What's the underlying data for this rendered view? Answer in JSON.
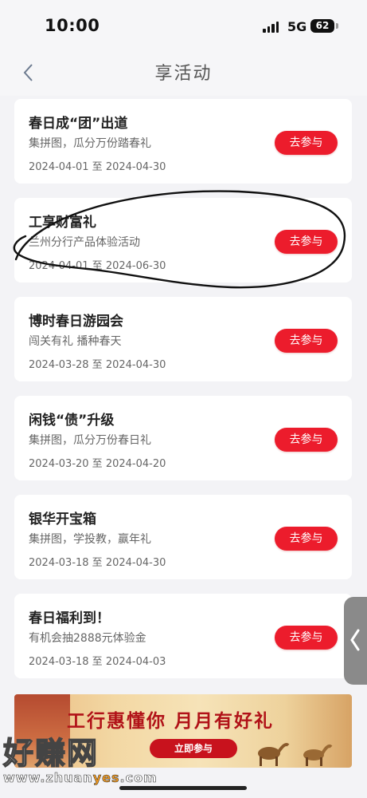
{
  "status_bar": {
    "time": "10:00",
    "network": "5G",
    "battery": "62"
  },
  "nav": {
    "title": "享活动",
    "back_icon": "chevron-left-icon"
  },
  "activities": [
    {
      "title": "春日成“团”出道",
      "desc": "集拼图，瓜分万份踏春礼",
      "date": "2024-04-01 至 2024-04-30",
      "button": "去参与"
    },
    {
      "title": "工享财富礼",
      "desc": "兰州分行产品体验活动",
      "date": "2024-04-01 至 2024-06-30",
      "button": "去参与"
    },
    {
      "title": "博时春日游园会",
      "desc": "闯关有礼 播种春天",
      "date": "2024-03-28 至 2024-04-30",
      "button": "去参与"
    },
    {
      "title": "闲钱“债”升级",
      "desc": "集拼图，瓜分万份春日礼",
      "date": "2024-03-20 至 2024-04-20",
      "button": "去参与"
    },
    {
      "title": "银华开宝箱",
      "desc": "集拼图，学投教，赢年礼",
      "date": "2024-03-18 至 2024-04-30",
      "button": "去参与"
    },
    {
      "title": "春日福利到！",
      "desc": "有机会抽2888元体验金",
      "date": "2024-03-18 至 2024-04-03",
      "button": "去参与"
    }
  ],
  "banner": {
    "title": "工行惠懂你 月月有好礼",
    "button": "立即参与"
  },
  "watermark": {
    "text": "好赚网",
    "url_prefix": "www.zhuan",
    "url_highlight": "yes",
    "url_suffix": ".com"
  },
  "colors": {
    "accent": "#ec1c2c",
    "background": "#f3f3f6"
  },
  "icons": {
    "side_tab": "chevron-left-icon"
  }
}
